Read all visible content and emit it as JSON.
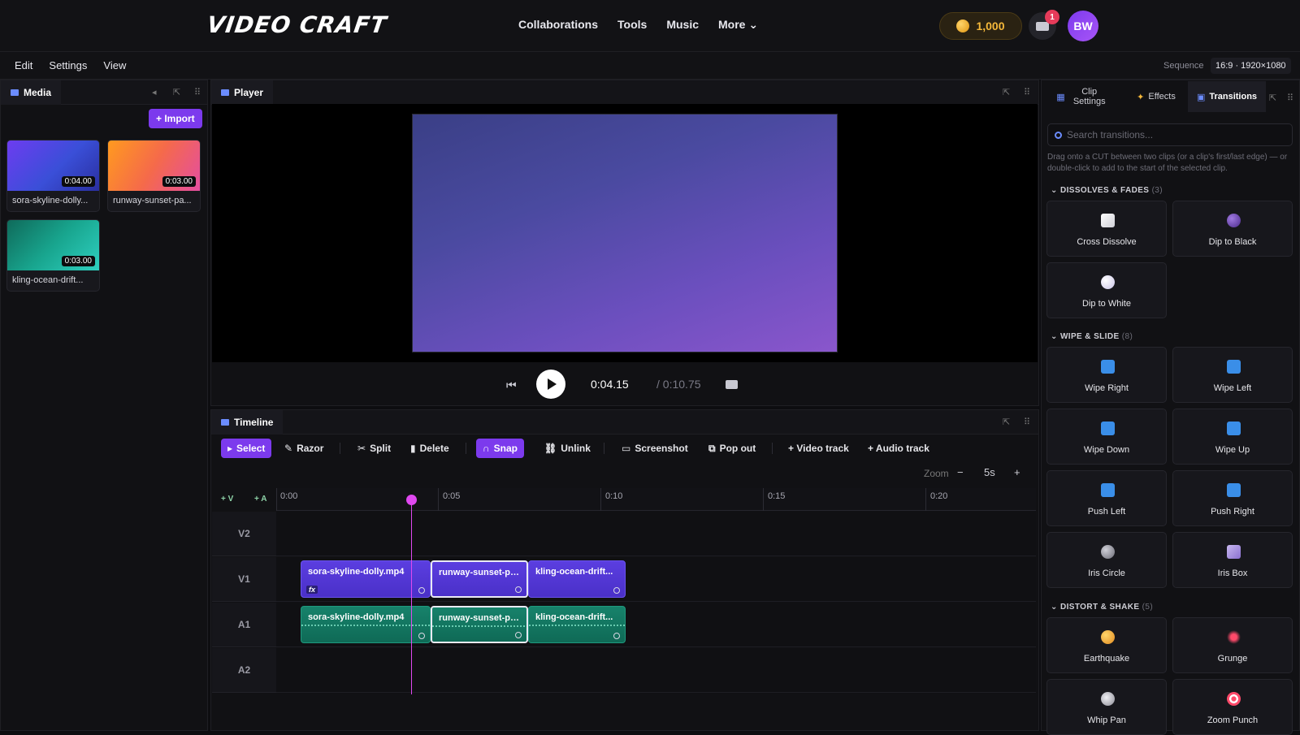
{
  "app": {
    "logo": "VIDEO CRAFT"
  },
  "nav": [
    "Collaborations",
    "Tools",
    "Music",
    "More ⌄"
  ],
  "user": {
    "coins": "1,000",
    "notifications": "1",
    "initials": "BW"
  },
  "menus": [
    "Edit",
    "Settings",
    "View"
  ],
  "sequence": {
    "label": "Sequence",
    "value": "16:9 · 1920×1080"
  },
  "media": {
    "title": "Media",
    "import_label": "+ Import",
    "items": [
      {
        "name": "sora-skyline-dolly...",
        "duration": "0:04.00"
      },
      {
        "name": "runway-sunset-pa...",
        "duration": "0:03.00"
      },
      {
        "name": "kling-ocean-drift...",
        "duration": "0:03.00"
      }
    ]
  },
  "player": {
    "title": "Player",
    "current": "0:04.15",
    "total": "/ 0:10.75"
  },
  "timeline": {
    "title": "Timeline",
    "tools": [
      "Select",
      "Razor",
      "Split",
      "Delete",
      "Snap",
      "Unlink",
      "Screenshot",
      "Pop out",
      "+ Video track",
      "+ Audio track"
    ],
    "zoom_label": "Zoom",
    "zoom_minus": "−",
    "zoom_value": "5s",
    "zoom_plus": "+",
    "add_v": "+ V",
    "add_a": "+ A",
    "ticks": [
      "0:00",
      "0:05",
      "0:10",
      "0:15",
      "0:20"
    ],
    "tracks": [
      "V2",
      "V1",
      "A1",
      "A2"
    ],
    "clips_v1": [
      "sora-skyline-dolly.mp4",
      "runway-sunset-pa...",
      "kling-ocean-drift..."
    ],
    "clips_a1": [
      "sora-skyline-dolly.mp4",
      "runway-sunset-pa...",
      "kling-ocean-drift..."
    ],
    "fx": "fx"
  },
  "right_panel": {
    "tabs": [
      "Clip Settings",
      "Effects",
      "Transitions"
    ],
    "search_placeholder": "Search transitions...",
    "hint": "Drag onto a CUT between two clips (or a clip's first/last edge) — or double-click to add to the start of the selected clip.",
    "sections": [
      {
        "name": "DISSOLVES & FADES",
        "count": "(3)",
        "items": [
          "Cross Dissolve",
          "Dip to Black",
          "Dip to White"
        ]
      },
      {
        "name": "WIPE & SLIDE",
        "count": "(8)",
        "items": [
          "Wipe Right",
          "Wipe Left",
          "Wipe Down",
          "Wipe Up",
          "Push Left",
          "Push Right",
          "Iris Circle",
          "Iris Box"
        ]
      },
      {
        "name": "DISTORT & SHAKE",
        "count": "(5)",
        "items": [
          "Earthquake",
          "Grunge",
          "Whip Pan",
          "Zoom Punch"
        ]
      }
    ]
  },
  "colors": {
    "accent": "#7c3aed",
    "video_clip": "#5b3ee0",
    "audio_clip": "#17826b",
    "playhead": "#e048f0"
  }
}
